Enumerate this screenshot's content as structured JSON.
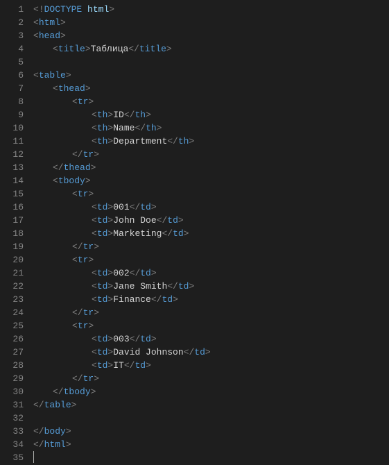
{
  "lines": [
    {
      "indent": 1,
      "tokens": [
        {
          "t": "<",
          "c": "br"
        },
        {
          "t": "!",
          "c": "br"
        },
        {
          "t": "DOCTYPE",
          "c": "doctype"
        },
        {
          "t": " ",
          "c": "txt"
        },
        {
          "t": "html",
          "c": "dockw"
        },
        {
          "t": ">",
          "c": "br"
        }
      ]
    },
    {
      "indent": 1,
      "tokens": [
        {
          "t": "<",
          "c": "br"
        },
        {
          "t": "html",
          "c": "tag"
        },
        {
          "t": ">",
          "c": "br"
        }
      ]
    },
    {
      "indent": 1,
      "tokens": [
        {
          "t": "<",
          "c": "br"
        },
        {
          "t": "head",
          "c": "tag"
        },
        {
          "t": ">",
          "c": "br"
        }
      ]
    },
    {
      "indent": 2,
      "tokens": [
        {
          "t": "<",
          "c": "br"
        },
        {
          "t": "title",
          "c": "tag"
        },
        {
          "t": ">",
          "c": "br"
        },
        {
          "t": "Таблица",
          "c": "txt"
        },
        {
          "t": "</",
          "c": "br"
        },
        {
          "t": "title",
          "c": "tag"
        },
        {
          "t": ">",
          "c": "br"
        }
      ]
    },
    {
      "indent": 1,
      "tokens": []
    },
    {
      "indent": 1,
      "tokens": [
        {
          "t": "<",
          "c": "br"
        },
        {
          "t": "table",
          "c": "tag"
        },
        {
          "t": ">",
          "c": "br"
        }
      ]
    },
    {
      "indent": 2,
      "tokens": [
        {
          "t": "<",
          "c": "br"
        },
        {
          "t": "thead",
          "c": "tag"
        },
        {
          "t": ">",
          "c": "br"
        }
      ]
    },
    {
      "indent": 3,
      "tokens": [
        {
          "t": "<",
          "c": "br"
        },
        {
          "t": "tr",
          "c": "tag"
        },
        {
          "t": ">",
          "c": "br"
        }
      ]
    },
    {
      "indent": 4,
      "tokens": [
        {
          "t": "<",
          "c": "br"
        },
        {
          "t": "th",
          "c": "tag"
        },
        {
          "t": ">",
          "c": "br"
        },
        {
          "t": "ID",
          "c": "txt"
        },
        {
          "t": "</",
          "c": "br"
        },
        {
          "t": "th",
          "c": "tag"
        },
        {
          "t": ">",
          "c": "br"
        }
      ]
    },
    {
      "indent": 4,
      "tokens": [
        {
          "t": "<",
          "c": "br"
        },
        {
          "t": "th",
          "c": "tag"
        },
        {
          "t": ">",
          "c": "br"
        },
        {
          "t": "Name",
          "c": "txt"
        },
        {
          "t": "</",
          "c": "br"
        },
        {
          "t": "th",
          "c": "tag"
        },
        {
          "t": ">",
          "c": "br"
        }
      ]
    },
    {
      "indent": 4,
      "tokens": [
        {
          "t": "<",
          "c": "br"
        },
        {
          "t": "th",
          "c": "tag"
        },
        {
          "t": ">",
          "c": "br"
        },
        {
          "t": "Department",
          "c": "txt"
        },
        {
          "t": "</",
          "c": "br"
        },
        {
          "t": "th",
          "c": "tag"
        },
        {
          "t": ">",
          "c": "br"
        }
      ]
    },
    {
      "indent": 3,
      "tokens": [
        {
          "t": "</",
          "c": "br"
        },
        {
          "t": "tr",
          "c": "tag"
        },
        {
          "t": ">",
          "c": "br"
        }
      ]
    },
    {
      "indent": 2,
      "tokens": [
        {
          "t": "</",
          "c": "br"
        },
        {
          "t": "thead",
          "c": "tag"
        },
        {
          "t": ">",
          "c": "br"
        }
      ]
    },
    {
      "indent": 2,
      "tokens": [
        {
          "t": "<",
          "c": "br"
        },
        {
          "t": "tbody",
          "c": "tag"
        },
        {
          "t": ">",
          "c": "br"
        }
      ]
    },
    {
      "indent": 3,
      "tokens": [
        {
          "t": "<",
          "c": "br"
        },
        {
          "t": "tr",
          "c": "tag"
        },
        {
          "t": ">",
          "c": "br"
        }
      ]
    },
    {
      "indent": 4,
      "tokens": [
        {
          "t": "<",
          "c": "br"
        },
        {
          "t": "td",
          "c": "tag"
        },
        {
          "t": ">",
          "c": "br"
        },
        {
          "t": "001",
          "c": "txt"
        },
        {
          "t": "</",
          "c": "br"
        },
        {
          "t": "td",
          "c": "tag"
        },
        {
          "t": ">",
          "c": "br"
        }
      ]
    },
    {
      "indent": 4,
      "tokens": [
        {
          "t": "<",
          "c": "br"
        },
        {
          "t": "td",
          "c": "tag"
        },
        {
          "t": ">",
          "c": "br"
        },
        {
          "t": "John Doe",
          "c": "txt"
        },
        {
          "t": "</",
          "c": "br"
        },
        {
          "t": "td",
          "c": "tag"
        },
        {
          "t": ">",
          "c": "br"
        }
      ]
    },
    {
      "indent": 4,
      "tokens": [
        {
          "t": "<",
          "c": "br"
        },
        {
          "t": "td",
          "c": "tag"
        },
        {
          "t": ">",
          "c": "br"
        },
        {
          "t": "Marketing",
          "c": "txt"
        },
        {
          "t": "</",
          "c": "br"
        },
        {
          "t": "td",
          "c": "tag"
        },
        {
          "t": ">",
          "c": "br"
        }
      ]
    },
    {
      "indent": 3,
      "tokens": [
        {
          "t": "</",
          "c": "br"
        },
        {
          "t": "tr",
          "c": "tag"
        },
        {
          "t": ">",
          "c": "br"
        }
      ]
    },
    {
      "indent": 3,
      "tokens": [
        {
          "t": "<",
          "c": "br"
        },
        {
          "t": "tr",
          "c": "tag"
        },
        {
          "t": ">",
          "c": "br"
        }
      ]
    },
    {
      "indent": 4,
      "tokens": [
        {
          "t": "<",
          "c": "br"
        },
        {
          "t": "td",
          "c": "tag"
        },
        {
          "t": ">",
          "c": "br"
        },
        {
          "t": "002",
          "c": "txt"
        },
        {
          "t": "</",
          "c": "br"
        },
        {
          "t": "td",
          "c": "tag"
        },
        {
          "t": ">",
          "c": "br"
        }
      ]
    },
    {
      "indent": 4,
      "tokens": [
        {
          "t": "<",
          "c": "br"
        },
        {
          "t": "td",
          "c": "tag"
        },
        {
          "t": ">",
          "c": "br"
        },
        {
          "t": "Jane Smith",
          "c": "txt"
        },
        {
          "t": "</",
          "c": "br"
        },
        {
          "t": "td",
          "c": "tag"
        },
        {
          "t": ">",
          "c": "br"
        }
      ]
    },
    {
      "indent": 4,
      "tokens": [
        {
          "t": "<",
          "c": "br"
        },
        {
          "t": "td",
          "c": "tag"
        },
        {
          "t": ">",
          "c": "br"
        },
        {
          "t": "Finance",
          "c": "txt"
        },
        {
          "t": "</",
          "c": "br"
        },
        {
          "t": "td",
          "c": "tag"
        },
        {
          "t": ">",
          "c": "br"
        }
      ]
    },
    {
      "indent": 3,
      "tokens": [
        {
          "t": "</",
          "c": "br"
        },
        {
          "t": "tr",
          "c": "tag"
        },
        {
          "t": ">",
          "c": "br"
        }
      ]
    },
    {
      "indent": 3,
      "tokens": [
        {
          "t": "<",
          "c": "br"
        },
        {
          "t": "tr",
          "c": "tag"
        },
        {
          "t": ">",
          "c": "br"
        }
      ]
    },
    {
      "indent": 4,
      "tokens": [
        {
          "t": "<",
          "c": "br"
        },
        {
          "t": "td",
          "c": "tag"
        },
        {
          "t": ">",
          "c": "br"
        },
        {
          "t": "003",
          "c": "txt"
        },
        {
          "t": "</",
          "c": "br"
        },
        {
          "t": "td",
          "c": "tag"
        },
        {
          "t": ">",
          "c": "br"
        }
      ]
    },
    {
      "indent": 4,
      "tokens": [
        {
          "t": "<",
          "c": "br"
        },
        {
          "t": "td",
          "c": "tag"
        },
        {
          "t": ">",
          "c": "br"
        },
        {
          "t": "David Johnson",
          "c": "txt"
        },
        {
          "t": "</",
          "c": "br"
        },
        {
          "t": "td",
          "c": "tag"
        },
        {
          "t": ">",
          "c": "br"
        }
      ]
    },
    {
      "indent": 4,
      "tokens": [
        {
          "t": "<",
          "c": "br"
        },
        {
          "t": "td",
          "c": "tag"
        },
        {
          "t": ">",
          "c": "br"
        },
        {
          "t": "IT",
          "c": "txt"
        },
        {
          "t": "</",
          "c": "br"
        },
        {
          "t": "td",
          "c": "tag"
        },
        {
          "t": ">",
          "c": "br"
        }
      ]
    },
    {
      "indent": 3,
      "tokens": [
        {
          "t": "</",
          "c": "br"
        },
        {
          "t": "tr",
          "c": "tag"
        },
        {
          "t": ">",
          "c": "br"
        }
      ]
    },
    {
      "indent": 2,
      "tokens": [
        {
          "t": "</",
          "c": "br"
        },
        {
          "t": "tbody",
          "c": "tag"
        },
        {
          "t": ">",
          "c": "br"
        }
      ]
    },
    {
      "indent": 1,
      "tokens": [
        {
          "t": "</",
          "c": "br"
        },
        {
          "t": "table",
          "c": "tag"
        },
        {
          "t": ">",
          "c": "br"
        }
      ]
    },
    {
      "indent": 1,
      "tokens": []
    },
    {
      "indent": 1,
      "tokens": [
        {
          "t": "</",
          "c": "br"
        },
        {
          "t": "body",
          "c": "tag"
        },
        {
          "t": ">",
          "c": "br"
        }
      ]
    },
    {
      "indent": 1,
      "tokens": [
        {
          "t": "</",
          "c": "br"
        },
        {
          "t": "html",
          "c": "tag"
        },
        {
          "t": ">",
          "c": "br"
        }
      ]
    },
    {
      "indent": 1,
      "tokens": [],
      "cursor": true
    }
  ]
}
